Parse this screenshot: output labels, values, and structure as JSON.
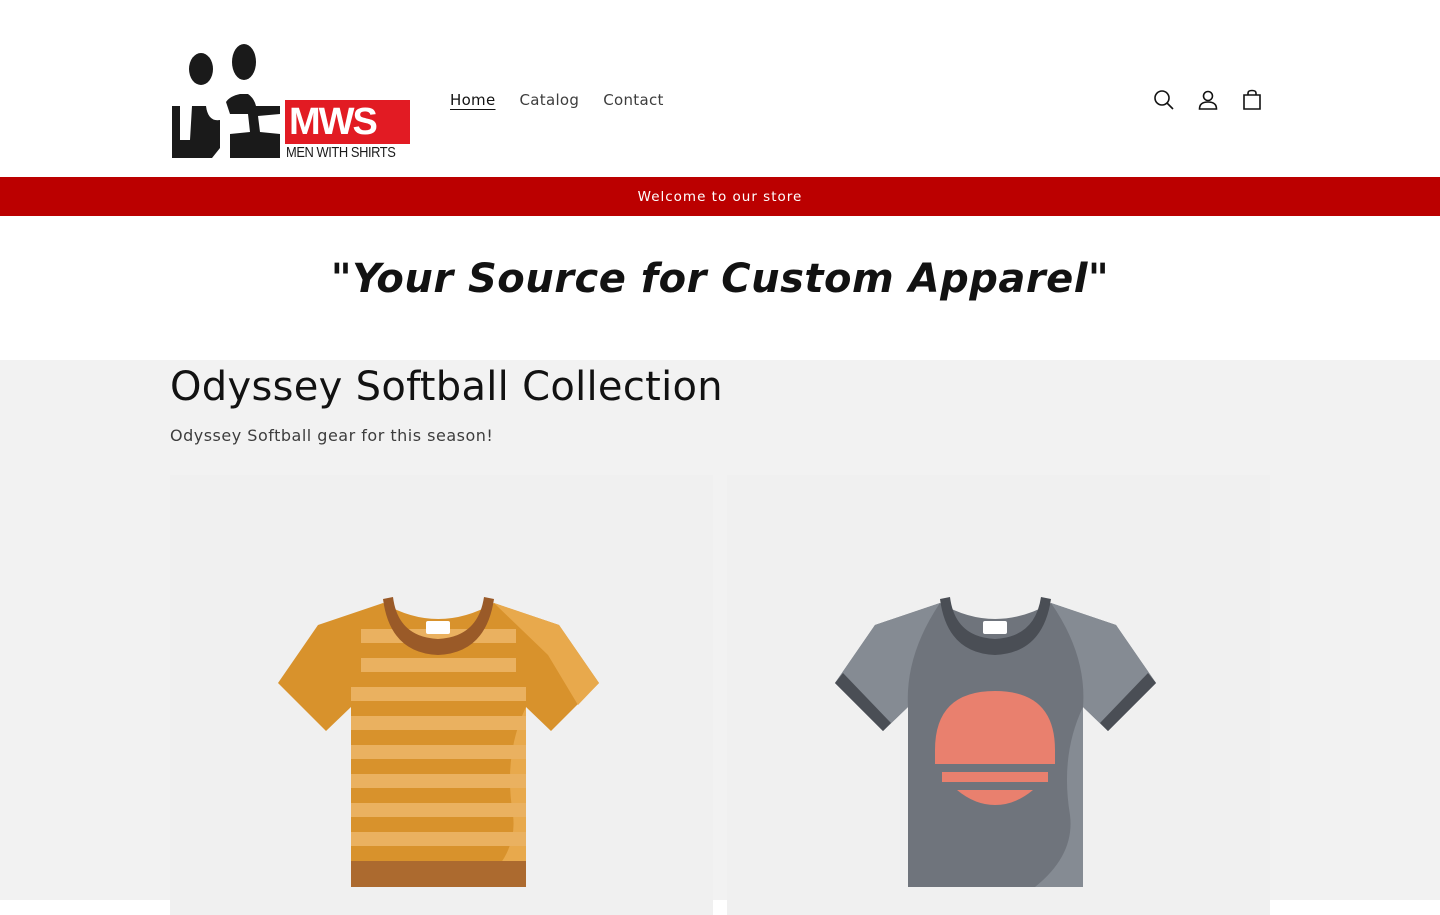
{
  "header": {
    "logo_text": "MWS",
    "logo_subtext": "MEN WITH SHIRTS",
    "nav": [
      {
        "label": "Home",
        "active": true
      },
      {
        "label": "Catalog",
        "active": false
      },
      {
        "label": "Contact",
        "active": false
      }
    ],
    "icons": [
      "search-icon",
      "account-icon",
      "cart-icon"
    ]
  },
  "announcement": {
    "text": "Welcome to our store",
    "background": "#bb0000"
  },
  "tagline": {
    "text": "\"Your Source for Custom Apparel\""
  },
  "collection": {
    "title": "Odyssey Softball Collection",
    "description": "Odyssey Softball gear for this season!",
    "products": [
      {
        "image": "orange-striped-tshirt"
      },
      {
        "image": "gray-sunset-tshirt"
      }
    ]
  },
  "colors": {
    "accent": "#bb0000",
    "background_muted": "#f2f2f2",
    "text": "#121212"
  }
}
